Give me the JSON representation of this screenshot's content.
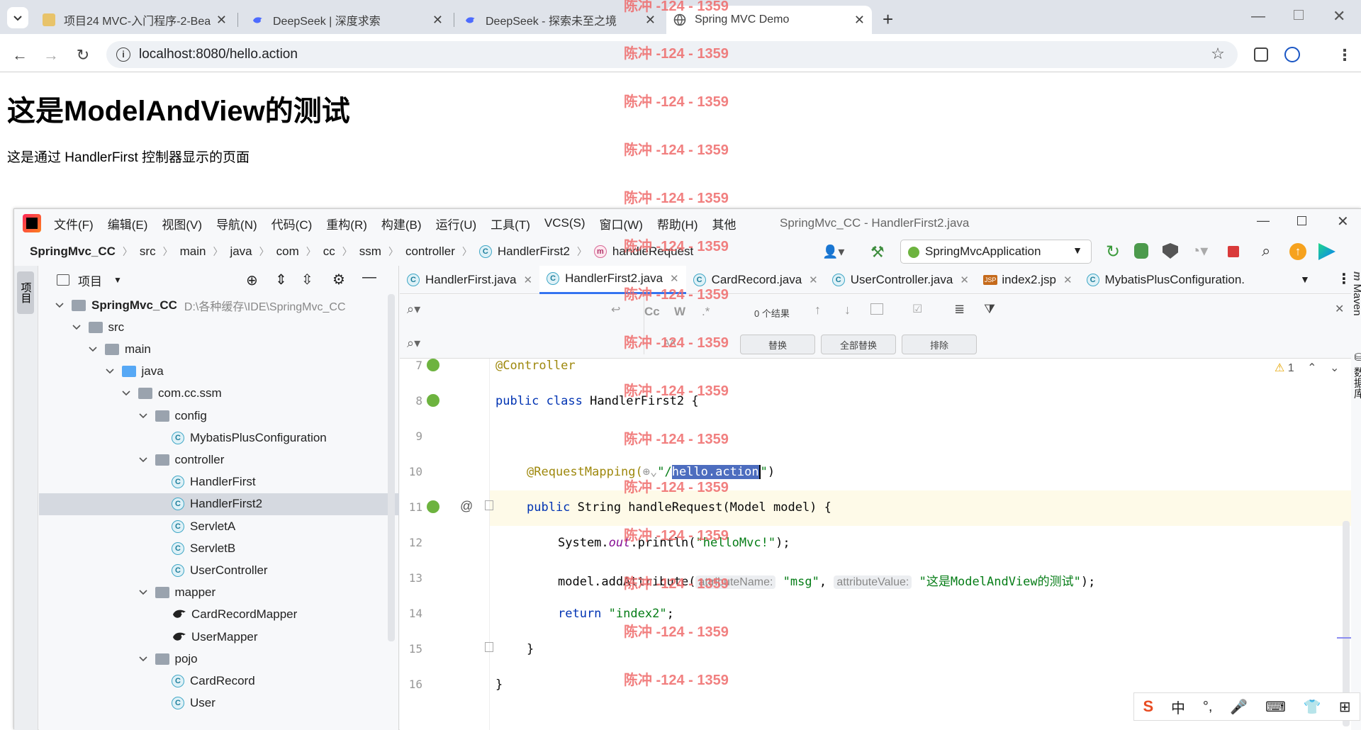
{
  "browser": {
    "tabs": [
      {
        "title": "项目24 MVC-入门程序-2-Bean"
      },
      {
        "title": "DeepSeek | 深度求索"
      },
      {
        "title": "DeepSeek - 探索未至之境"
      },
      {
        "title": "Spring MVC Demo"
      }
    ],
    "url": "localhost:8080/hello.action",
    "colors": {
      "tabbar": "#dfe3ea",
      "accent": "#3574f0"
    }
  },
  "page": {
    "heading": "这是ModelAndView的测试",
    "text": "这是通过 HandlerFirst 控制器显示的页面"
  },
  "watermark": "陈冲 -124 - 1359",
  "ide": {
    "menu": [
      "文件(F)",
      "编辑(E)",
      "视图(V)",
      "导航(N)",
      "代码(C)",
      "重构(R)",
      "构建(B)",
      "运行(U)",
      "工具(T)",
      "VCS(S)",
      "窗口(W)",
      "帮助(H)",
      "其他"
    ],
    "title": "SpringMvc_CC - HandlerFirst2.java",
    "breadcrumb": [
      "SpringMvc_CC",
      "src",
      "main",
      "java",
      "com",
      "cc",
      "ssm",
      "controller",
      "HandlerFirst2",
      "handleRequest"
    ],
    "run_config": "SpringMvcApplication",
    "project_panel_title": "项目",
    "left_strip_label": "项目",
    "right_strip": [
      "Maven",
      "数据库"
    ],
    "tree": [
      {
        "label": "SpringMvc_CC",
        "path": "D:\\各种缓存\\IDE\\SpringMvc_CC",
        "depth": 0,
        "kind": "module",
        "open": true
      },
      {
        "label": "src",
        "depth": 1,
        "kind": "folder",
        "open": true
      },
      {
        "label": "main",
        "depth": 2,
        "kind": "folder",
        "open": true
      },
      {
        "label": "java",
        "depth": 3,
        "kind": "folder",
        "open": true
      },
      {
        "label": "com.cc.ssm",
        "depth": 4,
        "kind": "folder",
        "open": true
      },
      {
        "label": "config",
        "depth": 5,
        "kind": "folder",
        "open": true
      },
      {
        "label": "MybatisPlusConfiguration",
        "depth": 6,
        "kind": "class"
      },
      {
        "label": "controller",
        "depth": 5,
        "kind": "folder",
        "open": true
      },
      {
        "label": "HandlerFirst",
        "depth": 6,
        "kind": "class"
      },
      {
        "label": "HandlerFirst2",
        "depth": 6,
        "kind": "class",
        "selected": true
      },
      {
        "label": "ServletA",
        "depth": 6,
        "kind": "class"
      },
      {
        "label": "ServletB",
        "depth": 6,
        "kind": "class"
      },
      {
        "label": "UserController",
        "depth": 6,
        "kind": "class"
      },
      {
        "label": "mapper",
        "depth": 5,
        "kind": "folder",
        "open": true
      },
      {
        "label": "CardRecordMapper",
        "depth": 6,
        "kind": "mapper"
      },
      {
        "label": "UserMapper",
        "depth": 6,
        "kind": "mapper"
      },
      {
        "label": "pojo",
        "depth": 5,
        "kind": "folder",
        "open": true
      },
      {
        "label": "CardRecord",
        "depth": 6,
        "kind": "class"
      },
      {
        "label": "User",
        "depth": 6,
        "kind": "class"
      }
    ],
    "editor_tabs": [
      {
        "label": "HandlerFirst.java",
        "icon": "C"
      },
      {
        "label": "HandlerFirst2.java",
        "icon": "C",
        "active": true
      },
      {
        "label": "CardRecord.java",
        "icon": "C"
      },
      {
        "label": "UserController.java",
        "icon": "C"
      },
      {
        "label": "index2.jsp",
        "icon": "JSP"
      },
      {
        "label": "MybatisPlusConfiguration.",
        "icon": "C"
      }
    ],
    "find": {
      "results": "0 个结果",
      "case": "Cc",
      "word": "W",
      "regex": ".*",
      "replace_btn": "替换",
      "replace_all_btn": "全部替换",
      "exclude_btn": "排除",
      "aa": "AA"
    },
    "warnings": "1",
    "code": {
      "lines": [
        "7",
        "8",
        "9",
        "10",
        "11",
        "12",
        "13",
        "14",
        "15",
        "16"
      ],
      "l7": "@Controller",
      "l8_kw1": "public",
      "l8_kw2": "class",
      "l8_rest": " HandlerFirst2 {",
      "l10_an": "@RequestMapping(",
      "l10_q1": "\"/",
      "l10_sel": "hello.action",
      "l10_q2": "\"",
      "l10_end": ")",
      "l11_kw": "public",
      "l11_rest": " String handleRequest(Model model) {",
      "l12_a": "System.",
      "l12_it": "out",
      "l12_b": ".println(",
      "l12_str": "\"helloMvc!\"",
      "l12_end": ");",
      "l13_a": "model.addAttribute(",
      "l13_h1": "attributeName:",
      "l13_s1": "\"msg\"",
      "l13_comma": ", ",
      "l13_h2": "attributeValue:",
      "l13_s2": "\"这是ModelAndView的测试\"",
      "l13_end": ");",
      "l14_kw": "return",
      "l14_str": "\"index2\"",
      "l14_end": ";",
      "l15": "}",
      "l16": "}"
    }
  },
  "tray": [
    "中",
    "°,",
    "🎤",
    "⌨",
    "👕",
    "⊞"
  ]
}
